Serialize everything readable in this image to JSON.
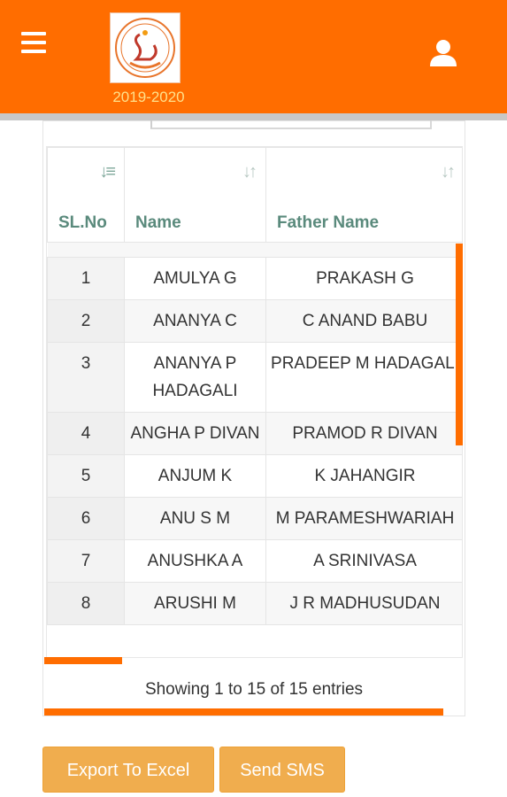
{
  "header": {
    "year": "2019-2020",
    "brand_color": "#ff6d00",
    "menu_icon": "hamburger-menu-icon",
    "user_icon": "user-icon"
  },
  "table": {
    "columns": [
      "SL.No",
      "Name",
      "Father Name"
    ],
    "rows": [
      {
        "sl": "1",
        "name": "AMULYA G",
        "father": "PRAKASH G"
      },
      {
        "sl": "2",
        "name": "ANANYA C",
        "father": "C ANAND BABU"
      },
      {
        "sl": "3",
        "name": "ANANYA P HADAGALI",
        "father": "PRADEEP M HADAGALI"
      },
      {
        "sl": "4",
        "name": "ANGHA P DIVAN",
        "father": "PRAMOD R DIVAN"
      },
      {
        "sl": "5",
        "name": "ANJUM K",
        "father": "K JAHANGIR"
      },
      {
        "sl": "6",
        "name": "ANU S M",
        "father": "M PARAMESHWARIAH"
      },
      {
        "sl": "7",
        "name": "ANUSHKA A",
        "father": "A SRINIVASA"
      },
      {
        "sl": "8",
        "name": "ARUSHI M",
        "father": "J R MADHUSUDAN"
      }
    ],
    "info": "Showing 1 to 15 of 15 entries"
  },
  "buttons": {
    "export": "Export To Excel",
    "sms": "Send SMS"
  },
  "colors": {
    "accent": "#ff6d00",
    "button": "#f0ad4e",
    "header_text": "#5a8a7c"
  }
}
